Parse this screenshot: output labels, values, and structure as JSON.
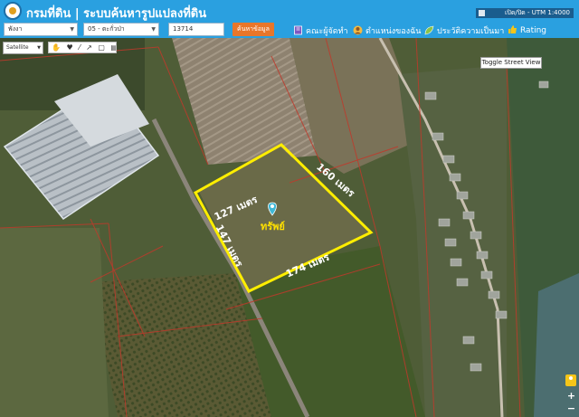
{
  "header": {
    "title": "กรมที่ดิน | ระบบค้นหารูปแปลงที่ดิน",
    "utm": "เปิด/ปิด - UTM 1:4000"
  },
  "toolbar": {
    "province": "พังงา",
    "district": "05 - ตะกั่วป่า",
    "parcel_no": "13714",
    "search_label": "ค้นหาข้อมูล",
    "menu": [
      {
        "label": "คณะผู้จัดทำ",
        "icon": "book-icon"
      },
      {
        "label": "ตำแหน่งของฉัน",
        "icon": "person-icon"
      },
      {
        "label": "ประวัติความเป็นมา",
        "icon": "leaf-icon"
      },
      {
        "label": "Rating",
        "icon": "thumbs-up-icon"
      }
    ]
  },
  "map": {
    "layer": "Satellite",
    "draw_tools": "✋ ♥ ⁄ ↗ ▢ ▤ ⬡",
    "street_view_label": "Toggle Street View",
    "zoom_in": "+",
    "zoom_out": "−",
    "parcel": {
      "marker_label": "ทรัพย์",
      "sides": [
        "127 เมตร",
        "160 เมตร",
        "174 เมตร",
        "147 เมตร"
      ]
    },
    "colors": {
      "boundary": "#ffee00",
      "lot_lines": "#c0392b",
      "marker": "#3fb8d6"
    }
  }
}
